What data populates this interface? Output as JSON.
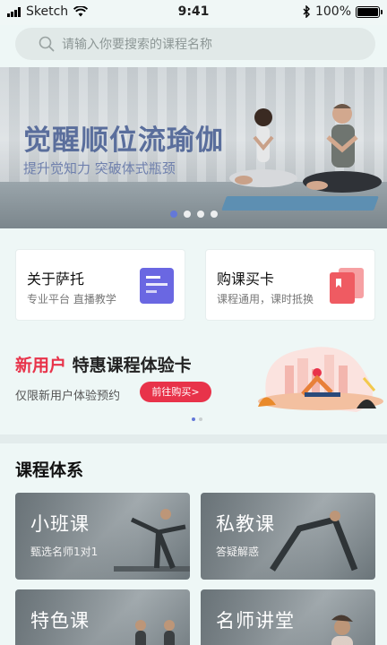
{
  "status_bar": {
    "carrier": "Sketch",
    "time": "9:41",
    "battery_text": "100%",
    "battery_level": 1.0
  },
  "search": {
    "placeholder": "请输入你要搜索的课程名称"
  },
  "banner": {
    "title": "觉醒顺位流瑜伽",
    "subtitle": "提升觉知力 突破体式瓶颈",
    "page_count": 4,
    "active_page": 1
  },
  "quick_cards": [
    {
      "title": "关于萨托",
      "desc": "专业平台 直播教学",
      "icon": "document-icon",
      "color": "#6a67e2"
    },
    {
      "title": "购课买卡",
      "desc": "课程通用，课时抵换",
      "icon": "card-icon",
      "color": "#ef5b62"
    }
  ],
  "promo": {
    "highlight": "新用户",
    "title": " 特惠课程体验卡",
    "subtitle": "仅限新用户体验预约",
    "button": "前往购买>",
    "page_count": 2,
    "active_page": 1
  },
  "courses": {
    "section_title": "课程体系",
    "items": [
      {
        "title": "小班课",
        "desc": "甄选名师1对1"
      },
      {
        "title": "私教课",
        "desc": "答疑解惑"
      },
      {
        "title": "特色课",
        "desc": ""
      },
      {
        "title": "名师讲堂",
        "desc": ""
      }
    ]
  },
  "colors": {
    "accent_red": "#e8334a",
    "banner_text": "#5a6e9c",
    "dot_active": "#6478d8"
  }
}
